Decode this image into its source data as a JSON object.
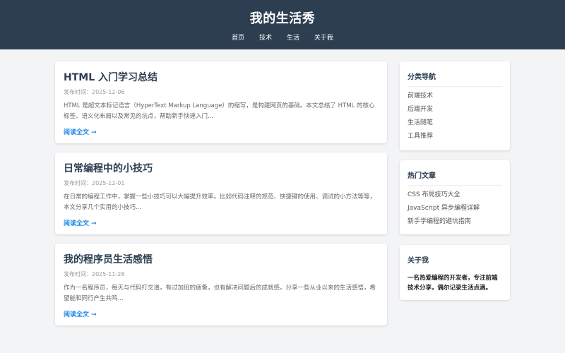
{
  "site": {
    "title": "我的生活秀",
    "nav": [
      "首页",
      "技术",
      "生活",
      "关于我"
    ]
  },
  "posts": [
    {
      "title": "HTML 入门学习总结",
      "date": "发布时间：2025-12-06",
      "excerpt": "HTML 是超文本标记语言（HyperText Markup Language）的缩写，是构建网页的基础。本文总结了 HTML 的核心标签、语义化布局以及常见的坑点，帮助新手快速入门...",
      "read_more": "阅读全文 →"
    },
    {
      "title": "日常编程中的小技巧",
      "date": "发布时间：2025-12-01",
      "excerpt": "在日常的编程工作中，掌握一些小技巧可以大幅提升效率。比如代码注释的规范、快捷键的使用、调试的小方法等等，本文分享几个实用的小技巧...",
      "read_more": "阅读全文 →"
    },
    {
      "title": "我的程序员生活感悟",
      "date": "发布时间：2025-11-28",
      "excerpt": "作为一名程序员，每天与代码打交道，有过加班的疲惫，也有解决问题后的成就感。分享一些从业以来的生活感悟，希望能和同行产生共鸣...",
      "read_more": "阅读全文 →"
    }
  ],
  "sidebar": {
    "categories": {
      "title": "分类导航",
      "items": [
        "前端技术",
        "后端开发",
        "生活随笔",
        "工具推荐"
      ]
    },
    "popular": {
      "title": "热门文章",
      "items": [
        "CSS 布局技巧大全",
        "JavaScript 异步编程详解",
        "新手学编程的避坑指南"
      ]
    },
    "about": {
      "title": "关于我",
      "text": "一名热爱编程的开发者，专注前端技术分享，偶尔记录生活点滴。"
    }
  }
}
